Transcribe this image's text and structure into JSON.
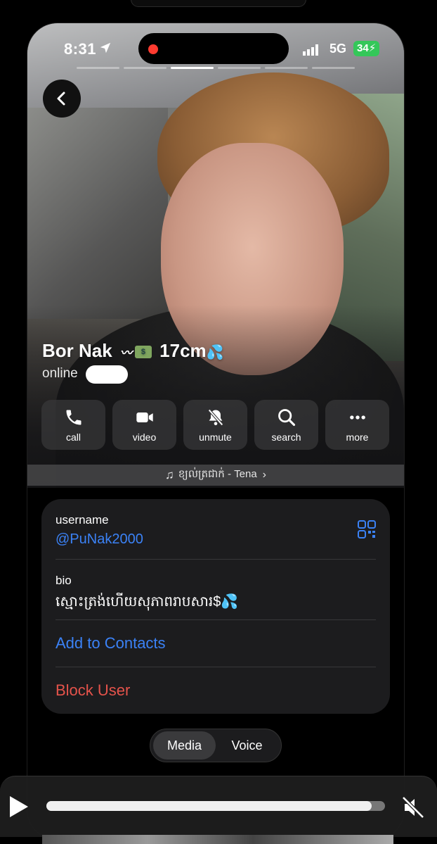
{
  "status_bar": {
    "time": "8:31",
    "network": "5G",
    "battery": "34"
  },
  "profile": {
    "name": "Bor Nak",
    "name_suffix": "17cm",
    "presence": "online"
  },
  "actions": [
    {
      "label": "call",
      "icon": "phone-icon"
    },
    {
      "label": "video",
      "icon": "video-camera-icon"
    },
    {
      "label": "unmute",
      "icon": "bell-slash-icon"
    },
    {
      "label": "search",
      "icon": "search-icon"
    },
    {
      "label": "more",
      "icon": "ellipsis-icon"
    }
  ],
  "music": {
    "title": "ខ្យល់ត្រជាក់ - Tena"
  },
  "info": {
    "username_label": "username",
    "username_value": "@PuNak2000",
    "bio_label": "bio",
    "bio_value": "ស្មោះត្រង់ហើយសុភាពរាបសារ$",
    "add_contact": "Add to Contacts",
    "block_user": "Block User"
  },
  "tabs": [
    {
      "label": "Media",
      "selected": true
    },
    {
      "label": "Voice",
      "selected": false
    }
  ],
  "player": {
    "progress": 0.96
  },
  "colors": {
    "link": "#3b82f6",
    "danger": "#e5534b",
    "battery": "#34c759",
    "record": "#ff3b30"
  }
}
